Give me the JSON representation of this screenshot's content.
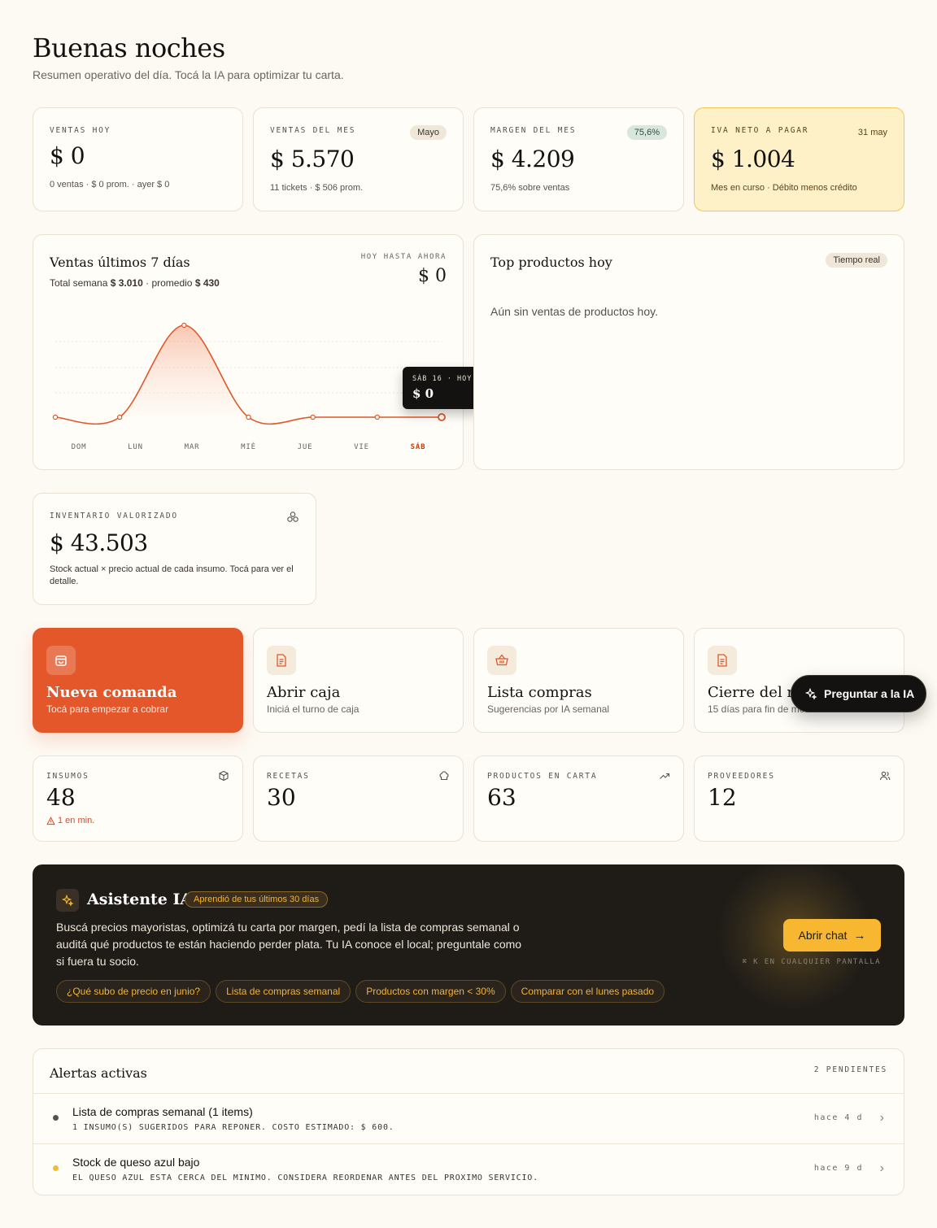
{
  "header": {
    "title": "Buenas noches",
    "subtitle": "Resumen operativo del día. Tocá la IA para optimizar tu carta."
  },
  "kpis": [
    {
      "label": "VENTAS HOY",
      "value": "$ 0",
      "sub": "0 ventas  ·  $ 0 prom.  ·  ayer $ 0",
      "badge": ""
    },
    {
      "label": "VENTAS DEL MES",
      "value": "$ 5.570",
      "sub": "11 tickets  ·  $ 506 prom.",
      "badge": "Mayo"
    },
    {
      "label": "MARGEN DEL MES",
      "value": "$ 4.209",
      "sub": "75,6% sobre ventas",
      "badge": "75,6%"
    },
    {
      "label": "IVA NETO A PAGAR",
      "value": "$ 1.004",
      "sub": "Mes en curso  ·  Débito menos crédito",
      "badge": "31 may"
    }
  ],
  "sales_chart": {
    "title": "Ventas últimos 7 días",
    "total_prefix": "Total semana",
    "total_value": "$ 3.010",
    "avg_prefix": "· promedio",
    "avg_value": "$ 430",
    "today_label": "HOY HASTA AHORA",
    "today_value": "$ 0",
    "tooltip_label": "SÁB 16 · HOY",
    "tooltip_value": "$ 0"
  },
  "chart_data": {
    "type": "line",
    "categories": [
      "DOM",
      "LUN",
      "MAR",
      "MIÉ",
      "JUE",
      "VIE",
      "SÁB"
    ],
    "series": [
      {
        "values": [
          0,
          0,
          3010,
          0,
          0,
          0,
          0
        ]
      }
    ],
    "highlight_category": "SÁB",
    "grid": true,
    "colors": {
      "line": "#e0572a",
      "highlight": "#c2410c"
    }
  },
  "top_products": {
    "title": "Top productos hoy",
    "badge": "Tiempo real",
    "empty": "Aún sin ventas de productos hoy."
  },
  "inventory": {
    "label": "INVENTARIO VALORIZADO",
    "value": "$ 43.503",
    "desc": "Stock actual × precio actual de cada insumo. Tocá para ver el detalle.",
    "icon": "boxes-icon"
  },
  "actions": [
    {
      "title": "Nueva comanda",
      "sub": "Tocá para empezar a cobrar",
      "icon": "bag-icon"
    },
    {
      "title": "Abrir caja",
      "sub": "Iniciá el turno de caja",
      "icon": "document-icon"
    },
    {
      "title": "Lista compras",
      "sub": "Sugerencias por IA semanal",
      "icon": "basket-icon"
    },
    {
      "title": "Cierre del mes",
      "sub": "15 días para fin de mes",
      "icon": "document-icon"
    }
  ],
  "floating_button": {
    "label": "Preguntar a la IA",
    "icon": "sparkles-icon"
  },
  "stats": [
    {
      "label": "INSUMOS",
      "value": "48",
      "note": "1 en min.",
      "icon": "cube-icon"
    },
    {
      "label": "RECETAS",
      "value": "30",
      "note": "",
      "icon": "chef-hat-icon"
    },
    {
      "label": "PRODUCTOS EN CARTA",
      "value": "63",
      "note": "",
      "icon": "trending-up-icon"
    },
    {
      "label": "PROVEEDORES",
      "value": "12",
      "note": "",
      "icon": "users-icon"
    }
  ],
  "assistant": {
    "title": "Asistente IA",
    "badge": "Aprendió de tus últimos 30 días",
    "desc": "Buscá precios mayoristas, optimizá tu carta por margen, pedí la lista de compras semanal o auditá qué productos te están haciendo perder plata. Tu IA conoce el local; preguntale como si fuera tu socio.",
    "cta": "Abrir chat",
    "shortcut": "⌘ K EN CUALQUIER PANTALLA",
    "chips": [
      "¿Qué subo de precio en junio?",
      "Lista de compras semanal",
      "Productos con margen < 30%",
      "Comparar con el lunes pasado"
    ]
  },
  "alerts": {
    "title": "Alertas activas",
    "count": "2 PENDIENTES",
    "items": [
      {
        "title": "Lista de compras semanal (1 items)",
        "desc": "1 INSUMO(S) SUGERIDOS PARA REPONER. COSTO ESTIMADO: $ 600.",
        "time": "hace 4 d",
        "color": "#57514a"
      },
      {
        "title": "Stock de queso azul bajo",
        "desc": "EL QUESO AZUL ESTA CERCA DEL MINIMO. CONSIDERA REORDENAR ANTES DEL PROXIMO SERVICIO.",
        "time": "hace 9 d",
        "color": "#f2b93b"
      }
    ]
  },
  "colors": {
    "accent": "#e4572a",
    "iva_bg": "#fef0c7",
    "dark": "#1f1c18",
    "cta": "#f7b731"
  }
}
